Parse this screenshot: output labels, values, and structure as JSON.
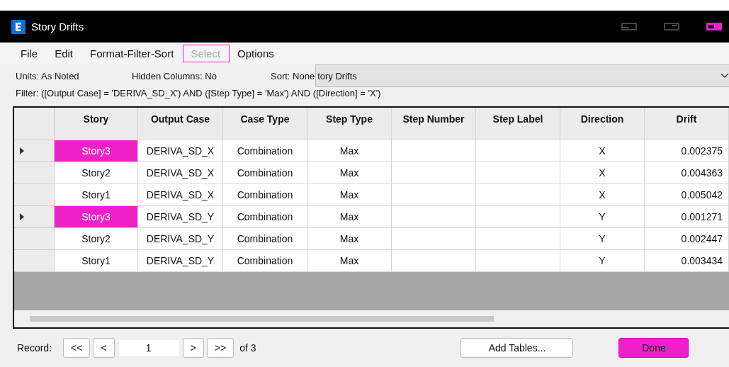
{
  "window": {
    "title": "Story Drifts"
  },
  "menu": [
    {
      "label": "File",
      "disabled": false,
      "selected": false
    },
    {
      "label": "Edit",
      "disabled": false,
      "selected": false
    },
    {
      "label": "Format-Filter-Sort",
      "disabled": false,
      "selected": false
    },
    {
      "label": "Select",
      "disabled": true,
      "selected": true
    },
    {
      "label": "Options",
      "disabled": false,
      "selected": false
    }
  ],
  "info": {
    "units": "Units:  As Noted",
    "hidden_columns": "Hidden Columns:  No",
    "sort": "Sort:  None",
    "table_select": "tory Drifts",
    "filter": "Filter:  ([Output Case] = 'DERIVA_SD_X') AND ([Step Type] = 'Max') AND ([Direction] = 'X')"
  },
  "table": {
    "columns": [
      "Story",
      "Output Case",
      "Case Type",
      "Step Type",
      "Step Number",
      "Step Label",
      "Direction",
      "Drift"
    ],
    "rows": [
      {
        "selected": true,
        "cells": [
          "Story3",
          "DERIVA_SD_X",
          "Combination",
          "Max",
          "",
          "",
          "X",
          "0.002375"
        ]
      },
      {
        "selected": false,
        "cells": [
          "Story2",
          "DERIVA_SD_X",
          "Combination",
          "Max",
          "",
          "",
          "X",
          "0.004363"
        ]
      },
      {
        "selected": false,
        "cells": [
          "Story1",
          "DERIVA_SD_X",
          "Combination",
          "Max",
          "",
          "",
          "X",
          "0.005042"
        ]
      },
      {
        "selected": true,
        "cells": [
          "Story3",
          "DERIVA_SD_Y",
          "Combination",
          "Max",
          "",
          "",
          "Y",
          "0.001271"
        ]
      },
      {
        "selected": false,
        "cells": [
          "Story2",
          "DERIVA_SD_Y",
          "Combination",
          "Max",
          "",
          "",
          "Y",
          "0.002447"
        ]
      },
      {
        "selected": false,
        "cells": [
          "Story1",
          "DERIVA_SD_Y",
          "Combination",
          "Max",
          "",
          "",
          "Y",
          "0.003434"
        ]
      }
    ]
  },
  "footer": {
    "record_label": "Record:",
    "first": "<<",
    "prev": "<",
    "record": "1",
    "next": ">",
    "last": ">>",
    "of": "of 3",
    "add_tables": "Add Tables...",
    "done": "Done"
  }
}
